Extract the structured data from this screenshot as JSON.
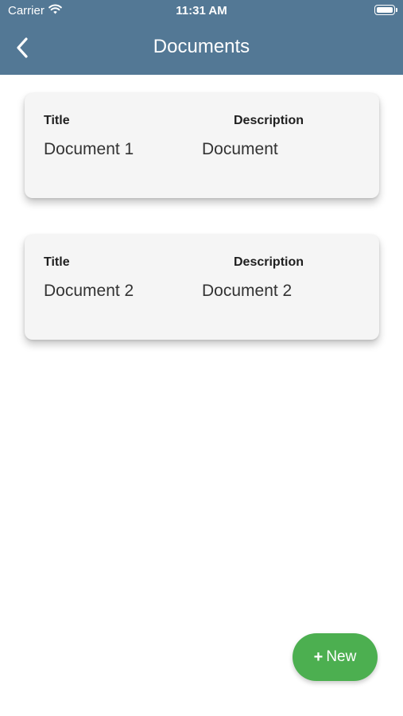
{
  "status_bar": {
    "carrier": "Carrier",
    "time": "11:31 AM"
  },
  "nav": {
    "title": "Documents"
  },
  "documents": [
    {
      "title_label": "Title",
      "description_label": "Description",
      "title": "Document 1",
      "description": "Document"
    },
    {
      "title_label": "Title",
      "description_label": "Description",
      "title": "Document 2",
      "description": "Document 2"
    }
  ],
  "fab": {
    "label": "New",
    "icon": "plus-icon"
  },
  "colors": {
    "header": "#537895",
    "card": "#f5f5f5",
    "fab": "#4caf50"
  }
}
